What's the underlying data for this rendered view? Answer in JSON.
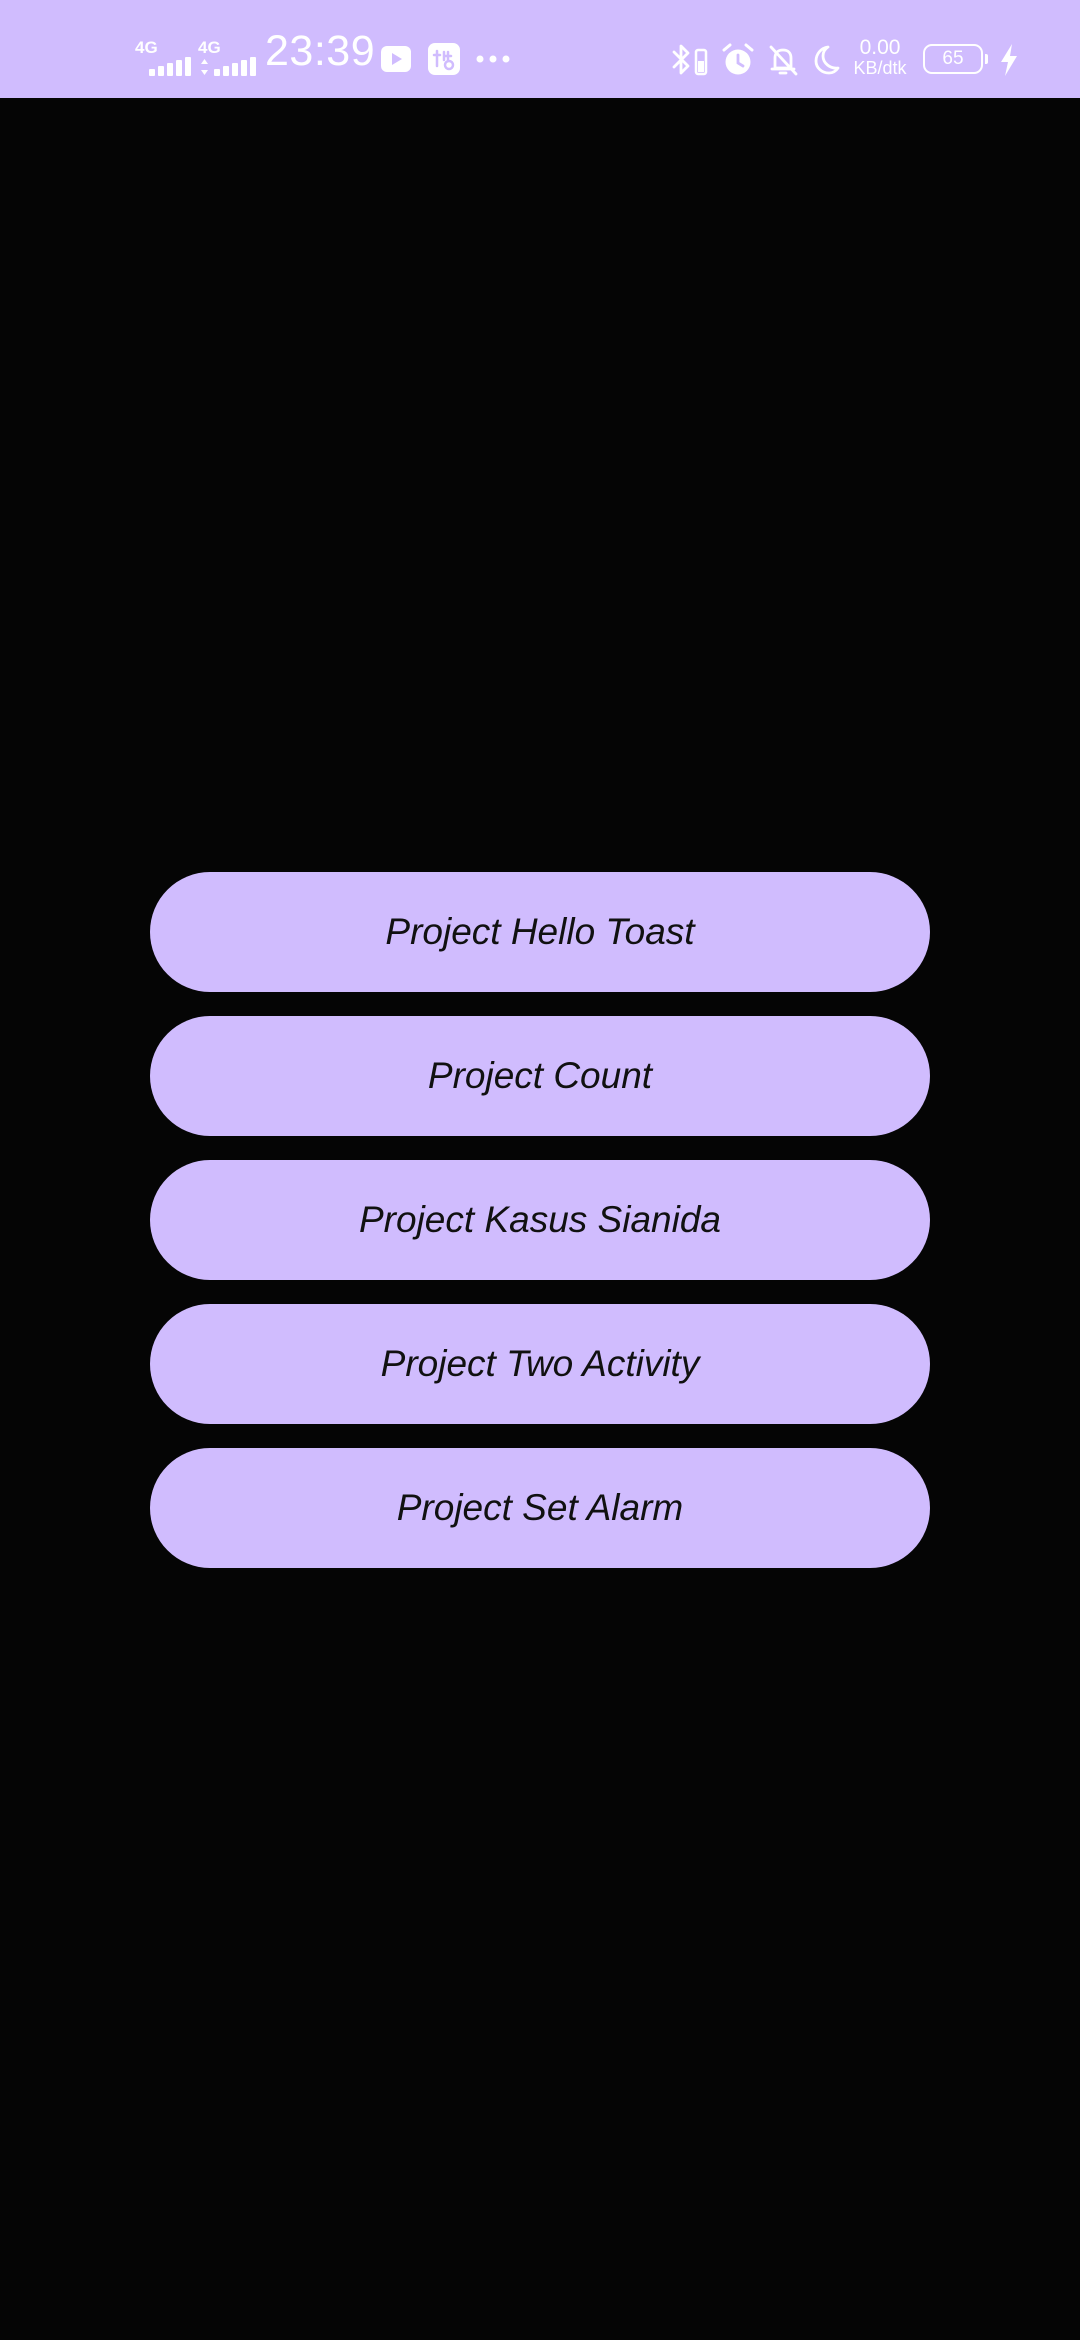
{
  "status_bar": {
    "network_1": "4G",
    "network_2": "4G",
    "time": "23:39",
    "net_speed_value": "0.00",
    "net_speed_unit": "KB/dtk",
    "battery_level": "65",
    "background_color": "#d0bcfe",
    "icons": [
      "signal-icon",
      "signal-icon",
      "video-play-icon",
      "app-notification-icon",
      "more-icon",
      "bluetooth-icon",
      "alarm-icon",
      "notifications-off-icon",
      "do-not-disturb-icon",
      "battery-icon",
      "charging-icon"
    ]
  },
  "menu": {
    "buttons": [
      {
        "label": "Project Hello Toast"
      },
      {
        "label": "Project Count"
      },
      {
        "label": "Project Kasus Sianida"
      },
      {
        "label": "Project Two Activity"
      },
      {
        "label": "Project Set Alarm"
      }
    ],
    "button_color": "#d0bcfe",
    "background_color": "#050505"
  }
}
